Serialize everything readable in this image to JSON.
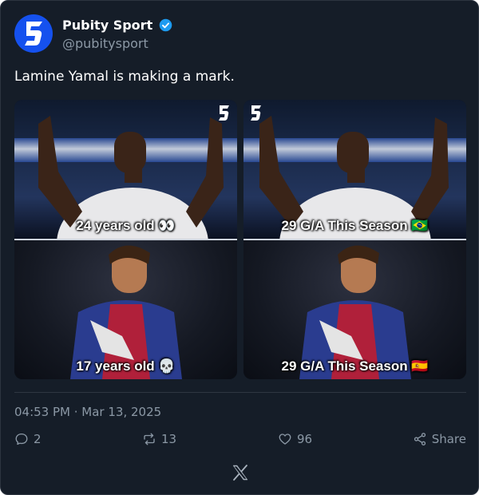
{
  "author": {
    "display_name": "Pubity Sport",
    "handle": "@pubitysport",
    "verified": true,
    "avatar_icon": "pubity-logo-icon"
  },
  "tweet": {
    "text": "Lamine Yamal is making a mark."
  },
  "media": {
    "left_panel": {
      "top_caption": "24 years old 👀",
      "bottom_caption": "17 years old 💀"
    },
    "right_panel": {
      "top_caption": "29 G/A This Season 🇧🇷",
      "bottom_caption": "29 G/A This Season 🇪🇸"
    }
  },
  "timestamp": "04:53 PM · Mar 13, 2025",
  "actions": {
    "reply_count": "2",
    "retweet_count": "13",
    "like_count": "96",
    "share_label": "Share"
  },
  "colors": {
    "card_bg": "#151d28",
    "avatar_bg": "#1551ee",
    "verified": "#1d9bf0",
    "muted": "#8b98a5"
  }
}
